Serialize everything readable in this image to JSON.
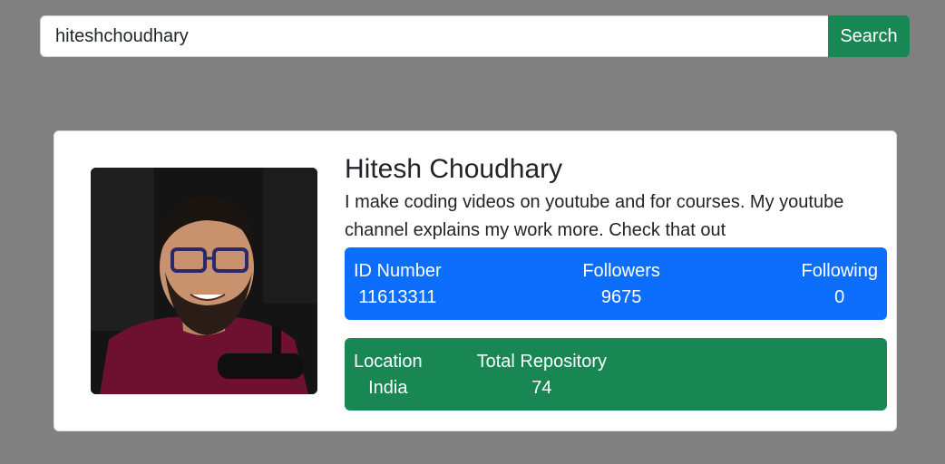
{
  "search": {
    "value": "hiteshchoudhary",
    "button_label": "Search"
  },
  "profile": {
    "name": "Hitesh Choudhary",
    "bio": "I make coding videos on youtube and for courses. My youtube channel explains my work more. Check that out",
    "avatar_icon": "user-avatar-photo"
  },
  "stats_primary": {
    "id_label": "ID Number",
    "id_value": "11613311",
    "followers_label": "Followers",
    "followers_value": "9675",
    "following_label": "Following",
    "following_value": "0"
  },
  "stats_secondary": {
    "location_label": "Location",
    "location_value": "India",
    "repos_label": "Total Repository",
    "repos_value": "74"
  },
  "colors": {
    "background": "#808080",
    "primary": "#0d6efd",
    "success": "#198754"
  }
}
